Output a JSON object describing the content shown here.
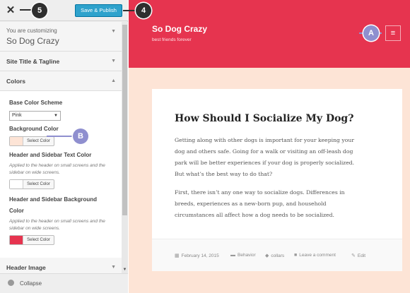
{
  "topbar": {
    "close_symbol": "✕",
    "publish_label": "Save & Publish"
  },
  "info": {
    "customizing_label": "You are customizing",
    "site_name": "So Dog Crazy"
  },
  "sections": {
    "title_tagline": "Site Title & Tagline",
    "colors": "Colors",
    "header_image": "Header Image"
  },
  "colors": {
    "base_label": "Base Color Scheme",
    "base_value": "Pink",
    "background_label": "Background Color",
    "header_text_label": "Header and Sidebar Text Color",
    "header_text_desc": "Applied to the header on small screens and the sidebar on wide screens.",
    "header_bg_label": "Header and Sidebar Background Color",
    "header_bg_desc": "Applied to the header on small screens and the sidebar on wide screens.",
    "select_color": "Select Color",
    "swatches": {
      "background": "#fde4d6",
      "header_text": "#ffffff",
      "header_bg": "#e6344f"
    }
  },
  "footer": {
    "collapse_label": "Collapse"
  },
  "preview": {
    "site_title": "So Dog Crazy",
    "tagline": "best friends forever",
    "menu_icon": "≡",
    "post": {
      "title": "How Should I Socialize My Dog?",
      "p1_lines": [
        "Getting along with other dogs is important for your keeping your",
        "dog and others safe. Going for a walk or visiting an off-leash dog",
        "park will be better experiences if your dog is properly socialized.",
        "But what’s the best way to do that?"
      ],
      "p2_lines": [
        "First, there isn’t any one way to socialize dogs. Differences in",
        "breeds, experiences as a new-born pup, and household",
        "circumstances all affect how a dog needs to be socialized."
      ]
    },
    "meta": {
      "date": "February 14, 2015",
      "category": "Behavior",
      "tag": "collars",
      "comment": "Leave a comment",
      "edit": "Edit"
    }
  },
  "callouts": {
    "five": "5",
    "four": "4",
    "a": "A",
    "b": "B"
  },
  "theme": {
    "header_color": "#e6344f",
    "background_color": "#fde4d6",
    "publish_color": "#2ea2cc"
  }
}
